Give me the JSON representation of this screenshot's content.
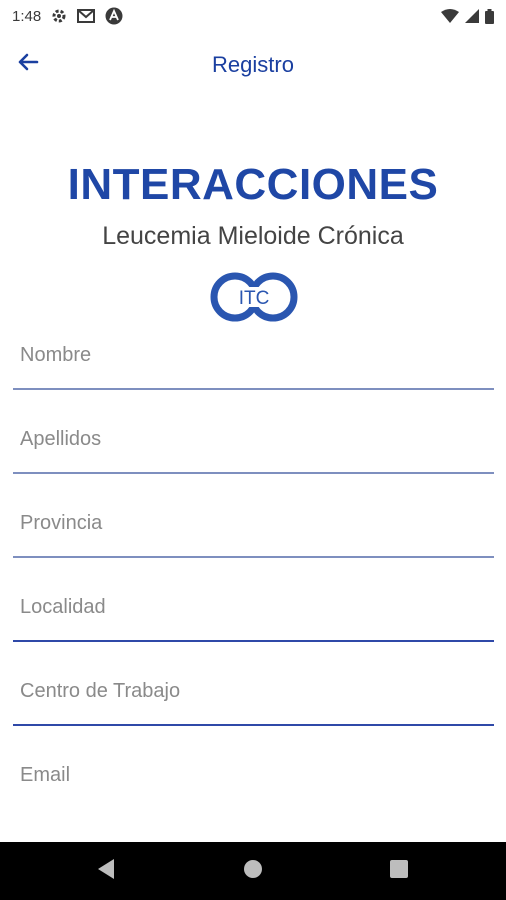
{
  "status_bar": {
    "time": "1:48",
    "icons": [
      "gear-icon",
      "gmail-icon",
      "app-notification-icon",
      "wifi-icon",
      "cell-signal-icon",
      "battery-icon"
    ]
  },
  "app_bar": {
    "title": "Registro",
    "back_icon": "arrow-left-icon"
  },
  "brand": {
    "title": "INTERACCIONES",
    "subtitle": "Leucemia Mieloide Crónica",
    "logo_text": "ITC"
  },
  "form": {
    "fields": [
      {
        "placeholder": "Nombre",
        "value": ""
      },
      {
        "placeholder": "Apellidos",
        "value": ""
      },
      {
        "placeholder": "Provincia",
        "value": ""
      },
      {
        "placeholder": "Localidad",
        "value": ""
      },
      {
        "placeholder": "Centro de Trabajo",
        "value": ""
      },
      {
        "placeholder": "Email",
        "value": ""
      }
    ]
  },
  "nav_bar": {
    "buttons": [
      "back-triangle-icon",
      "home-circle-icon",
      "recents-square-icon"
    ]
  },
  "colors": {
    "accent": "#1f47a6",
    "title_blue": "#1a3fa0",
    "underline": "#7e8fbf",
    "nav_bg": "#000000"
  }
}
